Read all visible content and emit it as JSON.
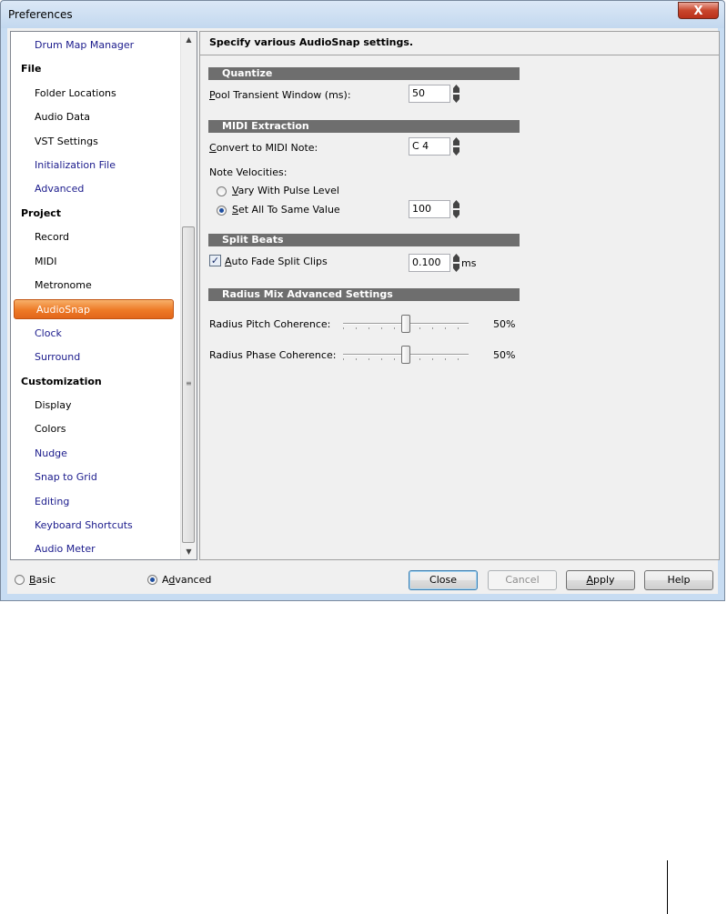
{
  "window": {
    "title": "Preferences",
    "close_glyph": "X"
  },
  "tree": {
    "items": [
      {
        "label": "Drum Map Manager",
        "kind": "child",
        "color": "blue"
      },
      {
        "label": "File",
        "kind": "cat"
      },
      {
        "label": "Folder Locations",
        "kind": "child",
        "color": "dark"
      },
      {
        "label": "Audio Data",
        "kind": "child",
        "color": "dark"
      },
      {
        "label": "VST Settings",
        "kind": "child",
        "color": "dark"
      },
      {
        "label": "Initialization File",
        "kind": "child",
        "color": "blue"
      },
      {
        "label": "Advanced",
        "kind": "child",
        "color": "blue"
      },
      {
        "label": "Project",
        "kind": "cat"
      },
      {
        "label": "Record",
        "kind": "child",
        "color": "dark"
      },
      {
        "label": "MIDI",
        "kind": "child",
        "color": "dark"
      },
      {
        "label": "Metronome",
        "kind": "child",
        "color": "dark"
      },
      {
        "label": "AudioSnap",
        "kind": "child",
        "color": "selected"
      },
      {
        "label": "Clock",
        "kind": "child",
        "color": "blue"
      },
      {
        "label": "Surround",
        "kind": "child",
        "color": "blue"
      },
      {
        "label": "Customization",
        "kind": "cat"
      },
      {
        "label": "Display",
        "kind": "child",
        "color": "dark"
      },
      {
        "label": "Colors",
        "kind": "child",
        "color": "dark"
      },
      {
        "label": "Nudge",
        "kind": "child",
        "color": "blue"
      },
      {
        "label": "Snap to Grid",
        "kind": "child",
        "color": "blue"
      },
      {
        "label": "Editing",
        "kind": "child",
        "color": "blue"
      },
      {
        "label": "Keyboard Shortcuts",
        "kind": "child",
        "color": "blue"
      },
      {
        "label": "Audio Meter",
        "kind": "child",
        "color": "blue"
      }
    ],
    "scroll_up": "▲",
    "scroll_down": "▼",
    "grip": "≡"
  },
  "panel": {
    "header": "Specify various AudioSnap settings.",
    "quantize": {
      "title": "Quantize",
      "pool_label": "Pool Transient Window (ms):",
      "pool_value": "50"
    },
    "midi": {
      "title": "MIDI Extraction",
      "convert_label": "Convert to MIDI Note:",
      "convert_value": "C 4",
      "velocities_label": "Note Velocities:",
      "vary_label": "Vary With Pulse Level",
      "set_label": "Set All To Same Value",
      "set_value": "100"
    },
    "split": {
      "title": "Split Beats",
      "fade_label": "Auto Fade Split Clips",
      "fade_value": "0.100",
      "fade_unit": "ms",
      "checkmark": "✓"
    },
    "radius": {
      "title": "Radius Mix Advanced Settings",
      "pitch_label": "Radius Pitch Coherence:",
      "pitch_value": "50%",
      "pitch_level": 0.5,
      "phase_label": "Radius Phase Coherence:",
      "phase_value": "50%",
      "phase_level": 0.5
    }
  },
  "footer": {
    "basic_label": "Basic",
    "advanced_label": "Advanced",
    "close_label": "Close",
    "cancel_label": "Cancel",
    "apply_label": "Apply",
    "help_label": "Help"
  },
  "colors": {
    "selection": "#ee7a26",
    "section_bar": "#6e6e6e",
    "link_text": "#1b1b8c"
  }
}
